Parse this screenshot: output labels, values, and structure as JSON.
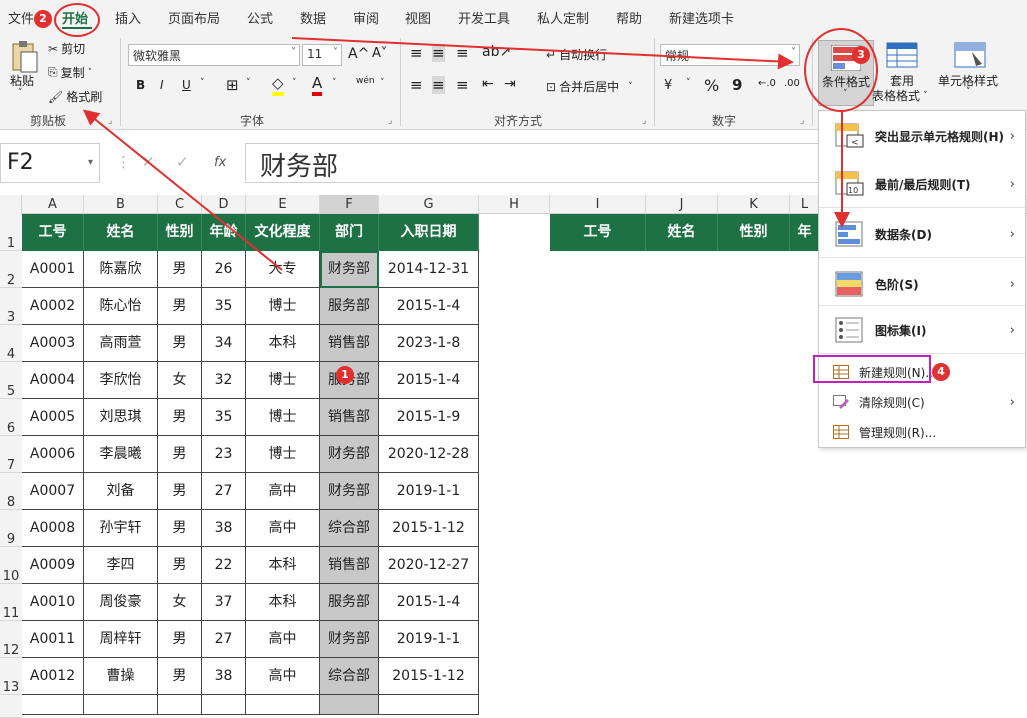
{
  "tabs": [
    "文件",
    "开始",
    "插入",
    "页面布局",
    "公式",
    "数据",
    "审阅",
    "视图",
    "开发工具",
    "私人定制",
    "帮助",
    "新建选项卡"
  ],
  "clipboard": {
    "paste": "粘贴",
    "cut": "剪切",
    "copy": "复制",
    "format_painter": "格式刷",
    "group": "剪贴板"
  },
  "font": {
    "name": "微软雅黑",
    "size": "11",
    "grow": "A^",
    "shrink": "A˅",
    "bold": "B",
    "italic": "I",
    "underline": "U",
    "wen": "wén",
    "group": "字体"
  },
  "alignment": {
    "wrap": "自动换行",
    "merge": "合并后居中",
    "group": "对齐方式"
  },
  "number": {
    "format": "常规",
    "percent": "%",
    "comma": "9",
    "group": "数字"
  },
  "styles": {
    "conditional": "条件格式",
    "table_line1": "套用",
    "table_line2": "表格格式",
    "cell_styles": "单元格样式"
  },
  "formula_bar": {
    "name_box": "F2",
    "fx": "fx",
    "content": "财务部"
  },
  "columns": [
    "A",
    "B",
    "C",
    "D",
    "E",
    "F",
    "G",
    "H",
    "I",
    "J",
    "K",
    "L"
  ],
  "rows": [
    "1",
    "2",
    "3",
    "4",
    "5",
    "6",
    "7",
    "8",
    "9",
    "10",
    "11",
    "12",
    "13"
  ],
  "headers": [
    "工号",
    "姓名",
    "性别",
    "年龄",
    "文化程度",
    "部门",
    "入职日期"
  ],
  "right_headers": [
    "工号",
    "姓名",
    "性别",
    "年"
  ],
  "table": [
    [
      "A0001",
      "陈嘉欣",
      "男",
      "26",
      "大专",
      "财务部",
      "2014-12-31"
    ],
    [
      "A0002",
      "陈心怡",
      "男",
      "35",
      "博士",
      "服务部",
      "2015-1-4"
    ],
    [
      "A0003",
      "高雨萱",
      "男",
      "34",
      "本科",
      "销售部",
      "2023-1-8"
    ],
    [
      "A0004",
      "李欣怡",
      "女",
      "32",
      "博士",
      "服务部",
      "2015-1-4"
    ],
    [
      "A0005",
      "刘思琪",
      "男",
      "35",
      "博士",
      "销售部",
      "2015-1-9"
    ],
    [
      "A0006",
      "李晨曦",
      "男",
      "23",
      "博士",
      "财务部",
      "2020-12-28"
    ],
    [
      "A0007",
      "刘备",
      "男",
      "27",
      "高中",
      "财务部",
      "2019-1-1"
    ],
    [
      "A0008",
      "孙宇轩",
      "男",
      "38",
      "高中",
      "综合部",
      "2015-1-12"
    ],
    [
      "A0009",
      "李四",
      "男",
      "22",
      "本科",
      "销售部",
      "2020-12-27"
    ],
    [
      "A0010",
      "周俊豪",
      "女",
      "37",
      "本科",
      "服务部",
      "2015-1-4"
    ],
    [
      "A0011",
      "周梓轩",
      "男",
      "27",
      "高中",
      "财务部",
      "2019-1-1"
    ],
    [
      "A0012",
      "曹操",
      "男",
      "38",
      "高中",
      "综合部",
      "2015-1-12"
    ]
  ],
  "menu": {
    "highlight": "突出显示单元格规则(H)",
    "topbottom": "最前/最后规则(T)",
    "databar": "数据条(D)",
    "colorscale": "色阶(S)",
    "iconset": "图标集(I)",
    "new_rule": "新建规则(N)...",
    "clear_rule": "清除规则(C)",
    "manage_rule": "管理规则(R)..."
  },
  "badges": [
    "1",
    "2",
    "3",
    "4"
  ],
  "colors": {
    "header_green": "#1e7145",
    "annotation_red": "#e03030",
    "highlight_purple": "#c020c0"
  }
}
